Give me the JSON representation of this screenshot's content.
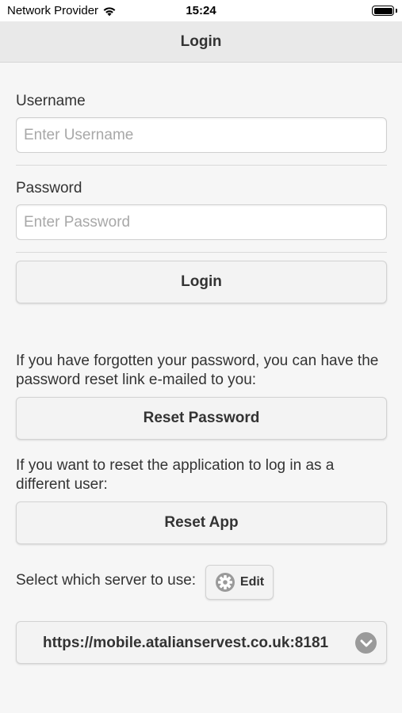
{
  "status_bar": {
    "carrier": "Network Provider",
    "time": "15:24"
  },
  "nav": {
    "title": "Login"
  },
  "form": {
    "username_label": "Username",
    "username_placeholder": "Enter Username",
    "username_value": "",
    "password_label": "Password",
    "password_placeholder": "Enter Password",
    "password_value": "",
    "login_button": "Login"
  },
  "reset": {
    "password_help": "If you have forgotten your password, you can have the password reset link e-mailed to you:",
    "password_button": "Reset Password",
    "app_help": "If you want to reset the application to log in as a different user:",
    "app_button": "Reset App"
  },
  "server": {
    "label": "Select which server to use:",
    "edit_button": "Edit",
    "selected": "https://mobile.atalianservest.co.uk:8181"
  },
  "icons": {
    "wifi": "wifi-icon",
    "battery": "battery-icon",
    "gear": "gear-icon",
    "chevron": "chevron-down-icon"
  }
}
